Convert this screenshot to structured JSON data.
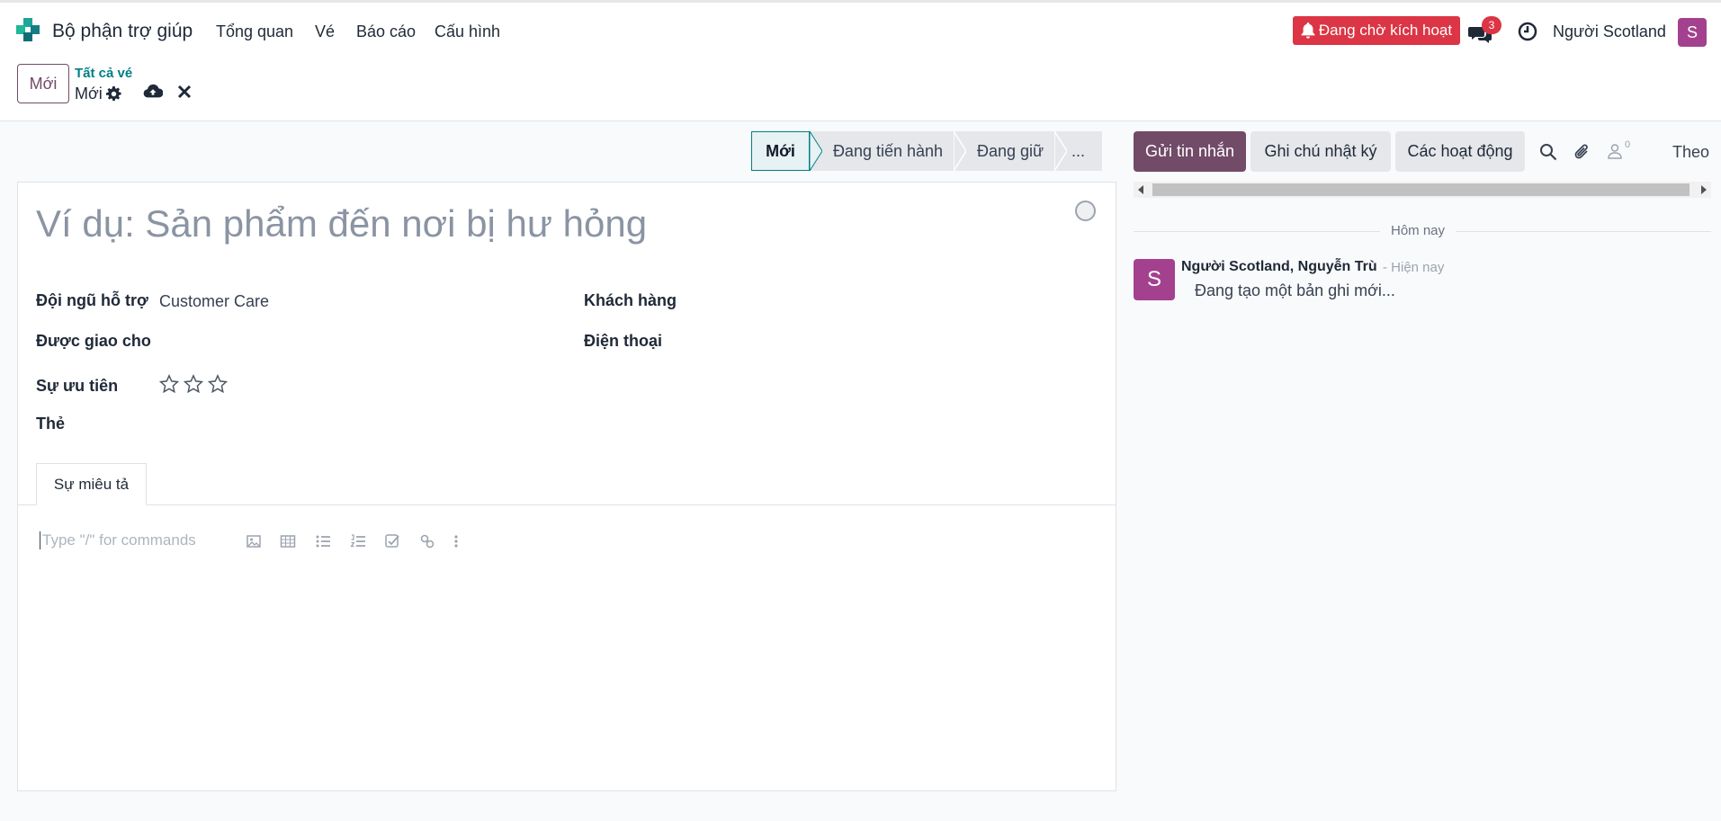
{
  "navbar": {
    "app_name": "Bộ phận trợ giúp",
    "menu": [
      "Tổng quan",
      "Vé",
      "Báo cáo",
      "Cấu hình"
    ],
    "activation_label": "Đang chờ kích hoạt",
    "message_count": "3",
    "user_name": "Người Scotland",
    "user_initial": "S"
  },
  "control": {
    "new_button": "Mới",
    "breadcrumb_parent": "Tất cả vé",
    "breadcrumb_current": "Mới"
  },
  "statusbar": {
    "stages": [
      "Mới",
      "Đang tiến hành",
      "Đang giữ",
      "..."
    ],
    "active_stage": "Mới"
  },
  "form": {
    "title_placeholder": "Ví dụ: Sản phẩm đến nơi bị hư hỏng",
    "team_label": "Đội ngũ hỗ trợ",
    "team_value": "Customer Care",
    "assigned_label": "Được giao cho",
    "priority_label": "Sự ưu tiên",
    "priority_value": 0,
    "priority_max": 3,
    "tags_label": "Thẻ",
    "customer_label": "Khách hàng",
    "phone_label": "Điện thoại",
    "tab_description": "Sự miêu tả",
    "editor_placeholder": "Type \"/\" for commands"
  },
  "chatter": {
    "send_message": "Gửi tin nhắn",
    "log_note": "Ghi chú nhật ký",
    "activities": "Các hoạt động",
    "followers_count": "0",
    "follow_label": "Theo",
    "date_separator": "Hôm nay",
    "message": {
      "avatar_initial": "S",
      "author": "Người Scotland, Nguyễn Trù",
      "time": "- Hiện nay",
      "body": "Đang tạo một bản ghi mới..."
    }
  },
  "colors": {
    "brand": "#714b67",
    "accent": "#017e84",
    "danger": "#dc3545",
    "avatar": "#a3418f"
  }
}
